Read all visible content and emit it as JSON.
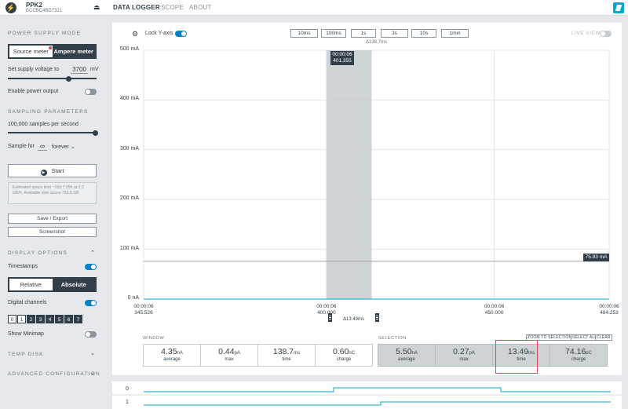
{
  "app": {
    "device_icon": "lightning-icon",
    "device_name": "PPK2",
    "device_serial": "ECCBC4BD7321",
    "nav_tabs": [
      "DATA LOGGER",
      "SCOPE",
      "ABOUT"
    ]
  },
  "sidebar": {
    "power_supply_heading": "POWER SUPPLY MODE",
    "source_meter": "Source meter",
    "ampere_meter": "Ampere meter",
    "voltage_label": "Set supply voltage to",
    "voltage_value": "3700",
    "voltage_unit": "mV",
    "enable_power": "Enable power output",
    "sampling_heading": "SAMPLING PARAMETERS",
    "samples_per_second": "100,000 samples per second",
    "sample_for": "Sample for",
    "sample_for_value": "∞",
    "sample_for_unit": "forever",
    "start_label": "Start",
    "info_text": "Estimated space limit ~15d 7:25h at 2.2 GB/h. Available disk space 793.6 GB",
    "save_export": "Save / Export",
    "screenshot": "Screenshot",
    "display_heading": "DISPLAY OPTIONS",
    "timestamps": "Timestamps",
    "relative": "Relative",
    "absolute": "Absolute",
    "digital_channels": "Digital channels",
    "channels": [
      "0",
      "1",
      "2",
      "3",
      "4",
      "5",
      "6",
      "7"
    ],
    "show_minimap": "Show Minimap",
    "temp_disk": "TEMP DISK",
    "advanced_config": "ADVANCED CONFIGURATION"
  },
  "toolbar": {
    "lock_y": "Lock Y-axis",
    "zoom_options": [
      "10ms",
      "100ms",
      "1s",
      "3s",
      "10s",
      "1min"
    ],
    "live_view": "LIVE VIEW"
  },
  "plot": {
    "delta_top": "Δ138.7ms",
    "delta_bottom": "Δ13.49ms",
    "cursor_time": "00:00:06",
    "cursor_value": "401.355",
    "value_flag": "75.93 mA",
    "y_ticks": [
      "500 mA",
      "400 mA",
      "300 mA",
      "200 mA",
      "100 mA",
      "0 nA"
    ],
    "x_ticks": [
      {
        "t": "00:00:06",
        "v": "345.526"
      },
      {
        "t": "00:00:06",
        "v": "400.000"
      },
      {
        "t": "00:00:06",
        "v": "450.000"
      },
      {
        "t": "00:00:06",
        "v": "484.253"
      }
    ]
  },
  "chart_data": {
    "type": "line",
    "x_range_ms": [
      345.526,
      484.253
    ],
    "ylim_mA": [
      0,
      500
    ],
    "y_ticks": [
      0,
      100,
      200,
      300,
      400,
      500
    ],
    "series": [
      {
        "values_mA": [
          75.93,
          75.93
        ]
      }
    ],
    "selection_ms": [
      400.0,
      413.49
    ]
  },
  "window": {
    "label": "WINDOW",
    "stats": [
      {
        "value": "4.35",
        "unit": "nA",
        "name": "average"
      },
      {
        "value": "0.44",
        "unit": "pA",
        "name": "max"
      },
      {
        "value": "138.7",
        "unit": "ms",
        "name": "time"
      },
      {
        "value": "0.60",
        "unit": "nC",
        "name": "charge"
      }
    ]
  },
  "selection": {
    "label": "SELECTION",
    "buttons": [
      "ZOOM TO SELECTION",
      "SELECT ALL",
      "CLEAR"
    ],
    "stats": [
      {
        "value": "5.50",
        "unit": "nA",
        "name": "average"
      },
      {
        "value": "0.27",
        "unit": "pA",
        "name": "max"
      },
      {
        "value": "13.49",
        "unit": "ms",
        "name": "time"
      },
      {
        "value": "74.16",
        "unit": "pC",
        "name": "charge"
      }
    ]
  },
  "minimap": {
    "labels": [
      "0",
      "1"
    ]
  },
  "colors": {
    "dark": "#333f48",
    "accent": "#0082c9",
    "line": "#00a9ce",
    "highlight": "#e04b5a"
  }
}
